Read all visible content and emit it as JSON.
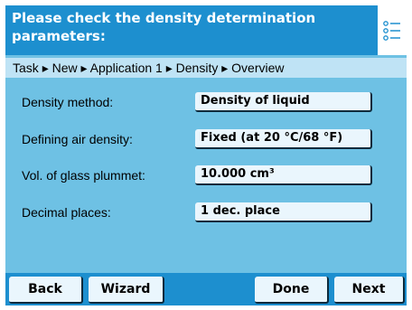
{
  "header": {
    "title": "Please check the density determination parameters:",
    "icon": "list-icon"
  },
  "breadcrumb": {
    "path": [
      "Task",
      "New",
      "Application 1",
      "Density",
      "Overview"
    ],
    "separator": "▸"
  },
  "parameters": [
    {
      "label": "Density method:",
      "value": "Density of liquid"
    },
    {
      "label": "Defining air density:",
      "value": "Fixed (at 20 °C/68 °F)"
    },
    {
      "label": "Vol. of glass plummet:",
      "value": "10.000 cm³"
    },
    {
      "label": "Decimal places:",
      "value": "1 dec. place"
    }
  ],
  "buttons": {
    "back": "Back",
    "wizard": "Wizard",
    "done": "Done",
    "next": "Next"
  },
  "colors": {
    "header": "#1d8fcf",
    "panel": "#6ec1e4",
    "breadcrumb": "#bfe3f5",
    "button": "#eaf6fd"
  }
}
